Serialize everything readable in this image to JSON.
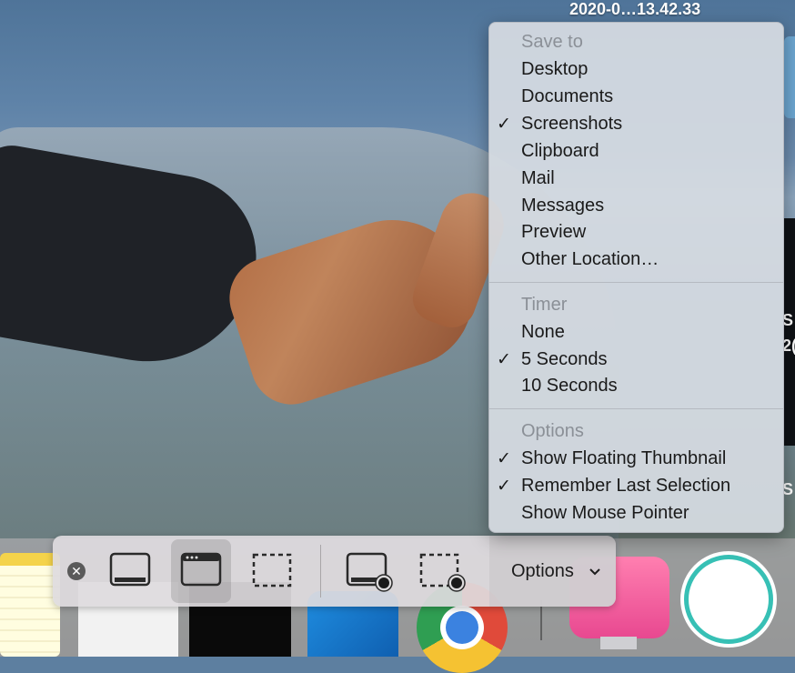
{
  "top_filename": "2020-0…13.42.33",
  "side_letters": [
    "S",
    "2(",
    "S"
  ],
  "menu": {
    "save_to_header": "Save to",
    "save_to_items": [
      {
        "label": "Desktop",
        "checked": false
      },
      {
        "label": "Documents",
        "checked": false
      },
      {
        "label": "Screenshots",
        "checked": true
      },
      {
        "label": "Clipboard",
        "checked": false
      },
      {
        "label": "Mail",
        "checked": false
      },
      {
        "label": "Messages",
        "checked": false
      },
      {
        "label": "Preview",
        "checked": false
      },
      {
        "label": "Other Location…",
        "checked": false
      }
    ],
    "timer_header": "Timer",
    "timer_items": [
      {
        "label": "None",
        "checked": false
      },
      {
        "label": "5 Seconds",
        "checked": true
      },
      {
        "label": "10 Seconds",
        "checked": false
      }
    ],
    "options_header": "Options",
    "options_items": [
      {
        "label": "Show Floating Thumbnail",
        "checked": true
      },
      {
        "label": "Remember Last Selection",
        "checked": true
      },
      {
        "label": "Show Mouse Pointer",
        "checked": false
      }
    ],
    "check_glyph": "✓"
  },
  "toolbar": {
    "close_glyph": "✕",
    "options_label": "Options",
    "selected_tool": "capture-selected-window",
    "tools": [
      "capture-entire-screen",
      "capture-selected-window",
      "capture-selected-portion",
      "record-entire-screen",
      "record-selected-portion"
    ]
  },
  "icons": {
    "close": "close-icon",
    "caret": "chevron-down-icon"
  }
}
